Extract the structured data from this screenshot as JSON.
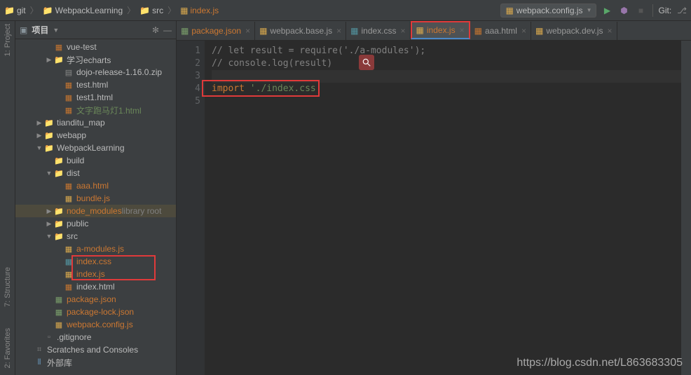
{
  "breadcrumb": {
    "items": [
      {
        "icon": "folder",
        "label": "git"
      },
      {
        "icon": "folder",
        "label": "WebpackLearning"
      },
      {
        "icon": "folder",
        "label": "src"
      },
      {
        "icon": "js",
        "label": "index.js"
      }
    ]
  },
  "run_config": "webpack.config.js",
  "git_label": "Git:",
  "left_strip": {
    "project": "1: Project",
    "structure": "7: Structure",
    "favorites": "2: Favorites"
  },
  "panel": {
    "title": "项目",
    "gear": "✻",
    "minus": "—"
  },
  "tree": [
    {
      "indent": 3,
      "arrow": "",
      "icon": "html",
      "label": "vue-test",
      "cls": ""
    },
    {
      "indent": 3,
      "arrow": "▶",
      "icon": "folder",
      "label": "学习echarts",
      "cls": ""
    },
    {
      "indent": 4,
      "arrow": "",
      "icon": "zip",
      "label": "dojo-release-1.16.0.zip",
      "cls": ""
    },
    {
      "indent": 4,
      "arrow": "",
      "icon": "html",
      "label": "test.html",
      "cls": ""
    },
    {
      "indent": 4,
      "arrow": "",
      "icon": "html",
      "label": "test1.html",
      "cls": ""
    },
    {
      "indent": 4,
      "arrow": "",
      "icon": "html",
      "label": "文字跑马灯1.html",
      "cls": "green-text"
    },
    {
      "indent": 2,
      "arrow": "▶",
      "icon": "folder",
      "label": "tianditu_map",
      "cls": ""
    },
    {
      "indent": 2,
      "arrow": "▶",
      "icon": "folder",
      "label": "webapp",
      "cls": ""
    },
    {
      "indent": 2,
      "arrow": "▼",
      "icon": "folder",
      "label": "WebpackLearning",
      "cls": ""
    },
    {
      "indent": 3,
      "arrow": "",
      "icon": "folder",
      "label": "build",
      "cls": ""
    },
    {
      "indent": 3,
      "arrow": "▼",
      "icon": "folder",
      "label": "dist",
      "cls": ""
    },
    {
      "indent": 4,
      "arrow": "",
      "icon": "html",
      "label": "aaa.html",
      "cls": "orange-text"
    },
    {
      "indent": 4,
      "arrow": "",
      "icon": "js",
      "label": "bundle.js",
      "cls": "orange-text"
    },
    {
      "indent": 3,
      "arrow": "▶",
      "icon": "folder",
      "label": "node_modules",
      "cls": "orange-text",
      "suffix": "library root",
      "row_cls": "lib-root"
    },
    {
      "indent": 3,
      "arrow": "▶",
      "icon": "folder",
      "label": "public",
      "cls": ""
    },
    {
      "indent": 3,
      "arrow": "▼",
      "icon": "folder",
      "label": "src",
      "cls": ""
    },
    {
      "indent": 4,
      "arrow": "",
      "icon": "js",
      "label": "a-modules.js",
      "cls": "orange-text"
    },
    {
      "indent": 4,
      "arrow": "",
      "icon": "css",
      "label": "index.css",
      "cls": "orange-text",
      "boxed": true
    },
    {
      "indent": 4,
      "arrow": "",
      "icon": "js",
      "label": "index.js",
      "cls": "orange-text",
      "boxed": true
    },
    {
      "indent": 4,
      "arrow": "",
      "icon": "html",
      "label": "index.html",
      "cls": ""
    },
    {
      "indent": 3,
      "arrow": "",
      "icon": "json",
      "label": "package.json",
      "cls": "orange-text"
    },
    {
      "indent": 3,
      "arrow": "",
      "icon": "json",
      "label": "package-lock.json",
      "cls": "orange-text"
    },
    {
      "indent": 3,
      "arrow": "",
      "icon": "js",
      "label": "webpack.config.js",
      "cls": "orange-text"
    },
    {
      "indent": 2,
      "arrow": "",
      "icon": "file",
      "label": ".gitignore",
      "cls": ""
    },
    {
      "indent": 1,
      "arrow": "",
      "icon": "scratch",
      "label": "Scratches and Consoles",
      "cls": ""
    },
    {
      "indent": 1,
      "arrow": "",
      "icon": "ext",
      "label": "外部库",
      "cls": ""
    }
  ],
  "tabs": [
    {
      "icon": "json",
      "label": "package.json",
      "orange": true
    },
    {
      "icon": "js",
      "label": "webpack.base.js",
      "orange": false
    },
    {
      "icon": "css",
      "label": "index.css",
      "orange": false
    },
    {
      "icon": "js",
      "label": "index.js",
      "orange": true,
      "active": true,
      "boxed": true
    },
    {
      "icon": "html",
      "label": "aaa.html",
      "orange": false
    },
    {
      "icon": "js",
      "label": "webpack.dev.js",
      "orange": false
    }
  ],
  "code": {
    "lines": [
      {
        "n": "1",
        "html": "// let result = require('./a-modules');",
        "cls": "cm-comment",
        "fold": true
      },
      {
        "n": "2",
        "html": "// console.log(result)",
        "cls": "cm-comment",
        "fold": true
      },
      {
        "n": "3",
        "html": "",
        "cls": "",
        "current": true
      },
      {
        "n": "4",
        "html": "",
        "cls": ""
      },
      {
        "n": "5",
        "html": "",
        "cls": ""
      }
    ],
    "import_kw": "import",
    "import_str": "'./index.css'"
  },
  "watermark": "https://blog.csdn.net/L863683305"
}
